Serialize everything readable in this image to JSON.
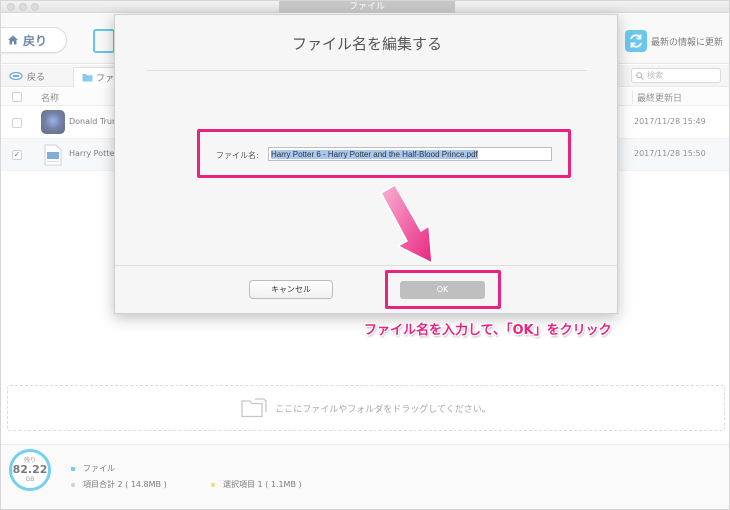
{
  "window": {
    "title": "ファイル"
  },
  "toolbar": {
    "back_label": "戻り",
    "refresh_label": "最新の情報に更新"
  },
  "pathbar": {
    "back_label": "戻る",
    "folder_tab_label": "ファ",
    "search_placeholder": "検索"
  },
  "list": {
    "col_name": "名称",
    "col_date": "最終更新日",
    "rows": [
      {
        "name": "Donald Trump",
        "date": "2017/11/28  15:49",
        "checked": false
      },
      {
        "name": "Harry Potter 6",
        "date": "2017/11/28  15:50",
        "checked": true
      }
    ],
    "check_mark": "✓"
  },
  "dropzone": {
    "label": "ここにファイルやフォルダをドラッグしてください。"
  },
  "footer": {
    "gauge_top": "残り",
    "gauge_value": "82.22",
    "gauge_unit": "GB",
    "legend_files": "ファイル",
    "total_items": "項目合計 2 ( 14.8MB )",
    "selected_items": "選択項目 1 ( 1.1MB )",
    "colors": {
      "files": "#2cb5e8",
      "total": "#bdbdbd",
      "selected": "#f5c518"
    }
  },
  "dialog": {
    "title": "ファイル名を編集する",
    "field_label": "ファイル名:",
    "field_value": "Harry Potter 6 - Harry Potter and the Half-Blood Prince.pdf",
    "cancel_label": "キャンセル",
    "ok_label": "OK"
  },
  "annotation": {
    "text": "ファイル名を入力して、「OK」をクリック",
    "color": "#e8247f"
  }
}
